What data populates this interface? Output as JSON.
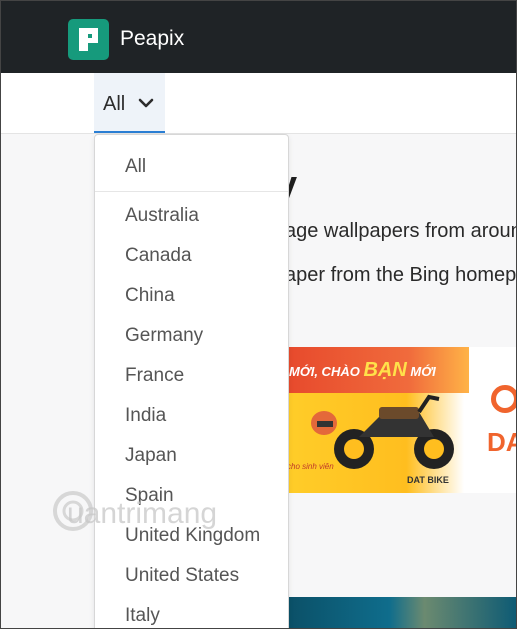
{
  "navbar": {
    "brand": "Peapix",
    "logo_icon": "peapix-logo-icon",
    "brand_color": "#169a7c",
    "background": "#1f2326"
  },
  "filter": {
    "selected": "All",
    "toggle_icon": "chevron-down-icon",
    "accent_color": "#2b7fd4"
  },
  "dropdown": {
    "items": [
      "All",
      "Australia",
      "Canada",
      "China",
      "Germany",
      "France",
      "India",
      "Japan",
      "Spain",
      "United Kingdom",
      "United States",
      "Italy"
    ]
  },
  "content": {
    "title_fragment": "y",
    "line1_fragment": "age wallpapers from aroun",
    "line2_fragment": "aper from the Bing homepa"
  },
  "ad": {
    "headline_pre": "MỚI, CHÀO",
    "headline_big": "BẠN",
    "headline_post": "MỚI",
    "sub": "cho sinh viên",
    "brand_small": "DAT BIKE",
    "brand_large": "DAT"
  },
  "watermark": {
    "text": "uantrimang"
  }
}
